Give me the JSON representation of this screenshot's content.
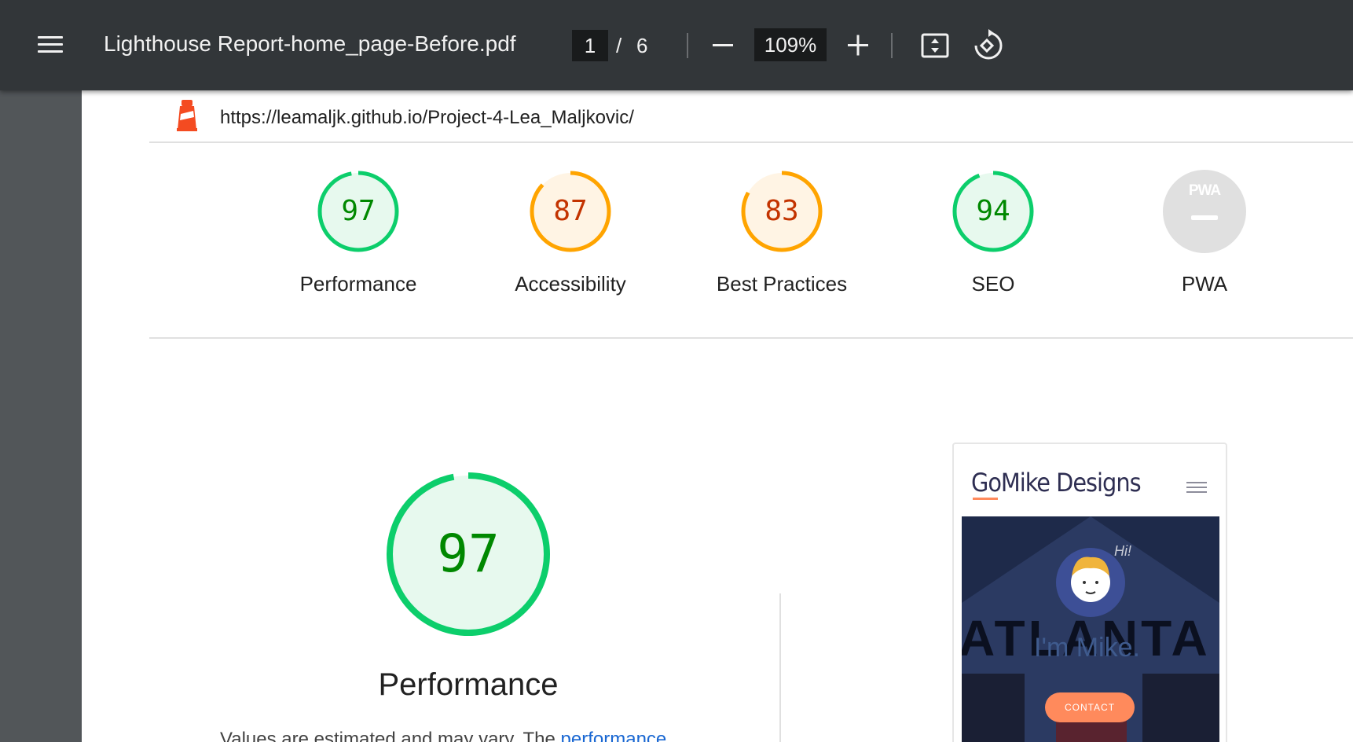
{
  "toolbar": {
    "title": "Lighthouse Report-home_page-Before.pdf",
    "current_page": "1",
    "page_separator": "/",
    "total_pages": "6",
    "zoom": "109%",
    "icons": [
      "menu-icon",
      "zoom-out-icon",
      "zoom-in-icon",
      "fit-page-icon",
      "rotate-icon"
    ]
  },
  "report": {
    "url": "https://leamaljk.github.io/Project-4-Lea_Maljkovic/",
    "categories": [
      {
        "label": "Performance",
        "score": "97",
        "score_value": 97,
        "rating": "pass"
      },
      {
        "label": "Accessibility",
        "score": "87",
        "score_value": 87,
        "rating": "average"
      },
      {
        "label": "Best Practices",
        "score": "83",
        "score_value": 83,
        "rating": "average"
      },
      {
        "label": "SEO",
        "score": "94",
        "score_value": 94,
        "rating": "pass"
      },
      {
        "label": "PWA",
        "badge_text": "PWA",
        "rating": "na"
      }
    ],
    "main": {
      "score": "97",
      "score_value": 97,
      "label": "Performance",
      "description_prefix": "Values are estimated and may vary. The ",
      "description_link": "performance"
    },
    "screenshot": {
      "brand": "GoMike Designs",
      "hi": "Hi!",
      "hero_text": "ATLANTA",
      "greeting": "I'm Mike.",
      "cta": "CONTACT"
    }
  },
  "colors": {
    "pass": "#0cce6b",
    "pass_text": "#008800",
    "pass_fill": "#e7f9ee",
    "average": "#ffa400",
    "average_text": "#c33300",
    "average_fill": "#fff4e4",
    "toolbar": "#323639",
    "viewer_bg": "#525659"
  }
}
